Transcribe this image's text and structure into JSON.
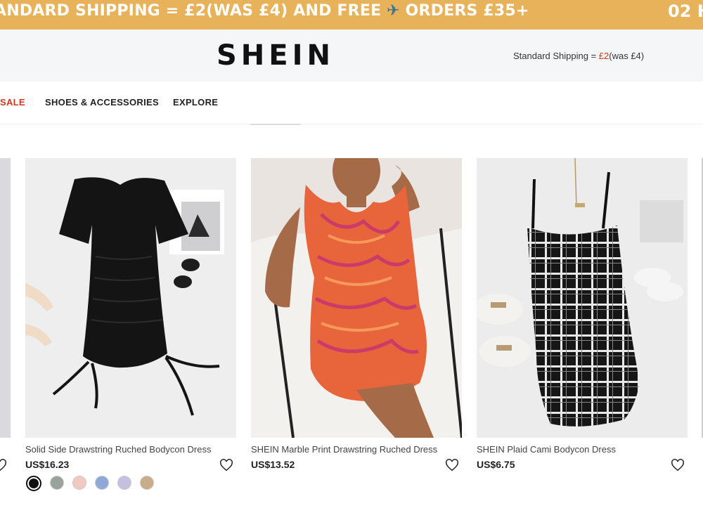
{
  "promo": {
    "text_before": "ANDARD SHIPPING = £2(WAS £4) AND FREE",
    "icon": "airplane-icon",
    "text_after": "ORDERS £35+",
    "timer": "02 H"
  },
  "header": {
    "logo": "SHEIN",
    "shipping_label": "Standard Shipping = ",
    "shipping_price": "£2",
    "shipping_was": "(was £4)"
  },
  "nav": {
    "items": [
      "SALE",
      "SHOES & ACCESSORIES",
      "EXPLORE"
    ]
  },
  "colors": {
    "promo_bg": "#e8b25a",
    "sale_red": "#d6371e",
    "header_bg": "#f4f6f8"
  },
  "products": [
    {
      "title": "Solid Side Drawstring Ruched Bodycon Dress",
      "price": "US$16.23",
      "swatches": [
        "#111111",
        "#9aa39a",
        "#f2c9c0",
        "#8fa8d8",
        "#c5c0e0",
        "#c8ac8c"
      ]
    },
    {
      "title": "SHEIN Marble Print Drawstring Ruched Dress",
      "price": "US$13.52",
      "swatches": []
    },
    {
      "title": "SHEIN Plaid Cami Bodycon Dress",
      "price": "US$6.75",
      "swatches": []
    }
  ]
}
